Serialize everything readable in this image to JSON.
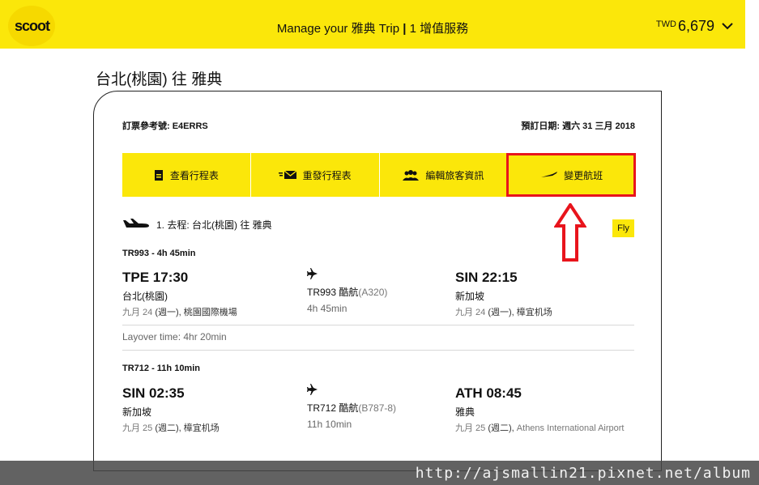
{
  "header": {
    "logo": "scoot",
    "title_prefix": "Manage your ",
    "title_dest": "雅典",
    "title_trip": " Trip",
    "title_sep": " | ",
    "title_suffix": "1 增值服務",
    "currency": "TWD",
    "amount": "6,679"
  },
  "route_title": "台北(桃園) 往 雅典",
  "booking": {
    "ref_label": "訂票參考號: E4ERRS",
    "date_label": "預訂日期: 週六 31 三月 2018"
  },
  "actions": [
    {
      "label": "查看行程表",
      "icon": "document-icon"
    },
    {
      "label": "重發行程表",
      "icon": "email-icon"
    },
    {
      "label": "編輯旅客資訊",
      "icon": "people-icon"
    },
    {
      "label": "變更航班",
      "icon": "plane-icon"
    }
  ],
  "outbound_label": "1. 去程: 台北(桃園) 往 雅典",
  "fly_badge": "Fly",
  "segments": [
    {
      "code": "TR993 - 4h 45min",
      "dep_time": "TPE 17:30",
      "dep_city": "台北(桃園)",
      "dep_date_a": "九月 24",
      "dep_date_b": " (週一), ",
      "dep_airport": "桃園國際機場",
      "flight_no": "TR993 酷航",
      "aircraft": "(A320)",
      "duration": "4h 45min",
      "arr_time": "SIN 22:15",
      "arr_city": "新加坡",
      "arr_date_a": "九月 24",
      "arr_date_b": " (週一), ",
      "arr_airport": "樟宜机场"
    },
    {
      "code": "TR712 - 11h 10min",
      "dep_time": "SIN 02:35",
      "dep_city": "新加坡",
      "dep_date_a": "九月 25",
      "dep_date_b": " (週二), ",
      "dep_airport": "樟宜机场",
      "flight_no": "TR712 酷航",
      "aircraft": "(B787-8)",
      "duration": "11h 10min",
      "arr_time": "ATH 08:45",
      "arr_city": "雅典",
      "arr_date_a": "九月 25",
      "arr_date_b": " (週二), ",
      "arr_airport": "Athens International Airport"
    }
  ],
  "layover": "Layover time: 4hr 20min",
  "watermark": "http://ajsmallin21.pixnet.net/album",
  "colors": {
    "brand_yellow": "#fbe70a",
    "highlight_red": "#e8141c"
  }
}
